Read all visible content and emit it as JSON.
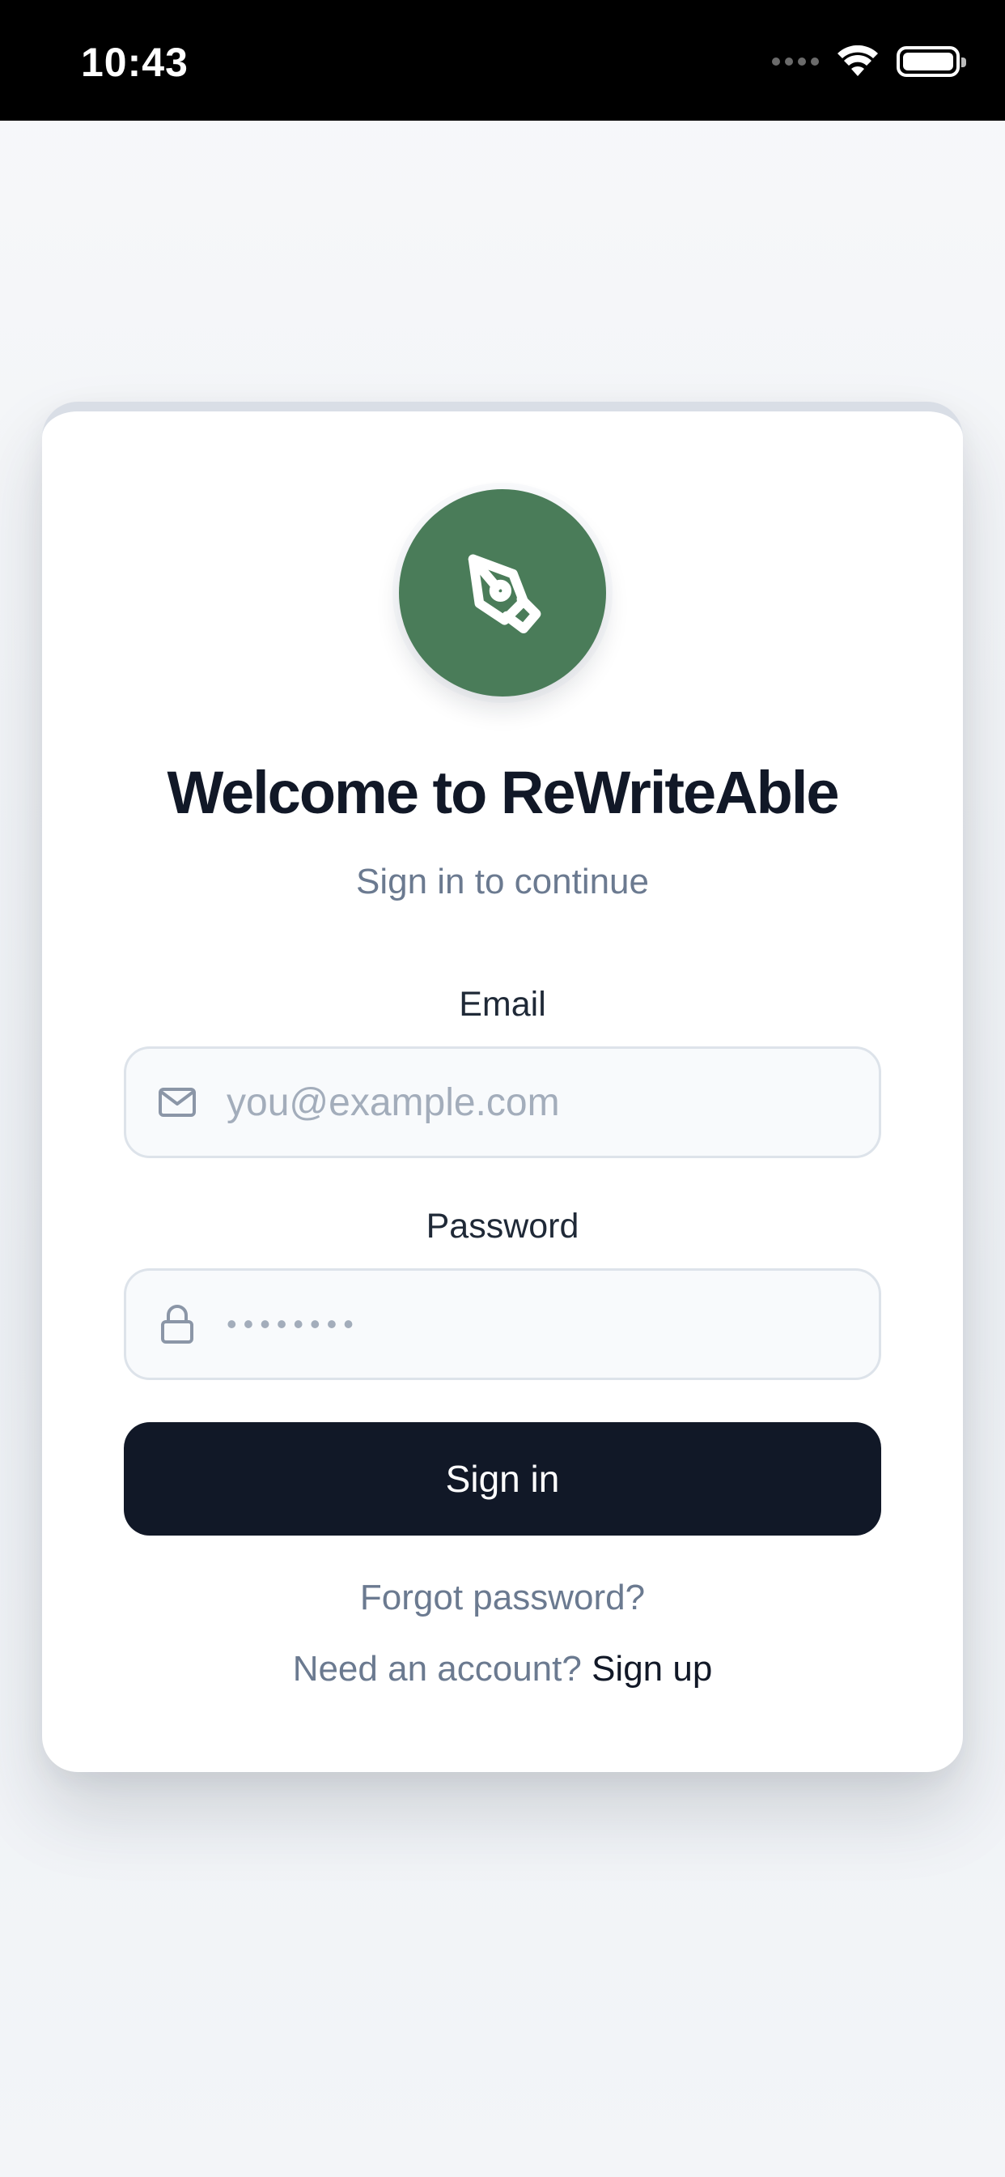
{
  "status_bar": {
    "time": "10:43",
    "icons": [
      "signal-dots-icon",
      "wifi-icon",
      "battery-icon"
    ]
  },
  "logo": {
    "icon": "pen-nib-icon",
    "background_color": "#4a7c59"
  },
  "header": {
    "title": "Welcome to ReWriteAble",
    "subtitle": "Sign in to continue"
  },
  "form": {
    "email": {
      "label": "Email",
      "placeholder": "you@example.com",
      "value": "",
      "icon": "mail-icon"
    },
    "password": {
      "label": "Password",
      "placeholder": "••••••••",
      "value": "",
      "icon": "lock-icon"
    },
    "submit_label": "Sign in"
  },
  "links": {
    "forgot_password": "Forgot password?",
    "signup_prompt": "Need an account?",
    "signup_label": "Sign up"
  },
  "colors": {
    "primary_button": "#111827",
    "brand_green": "#4a7c59",
    "muted_text": "#6b7a90"
  }
}
